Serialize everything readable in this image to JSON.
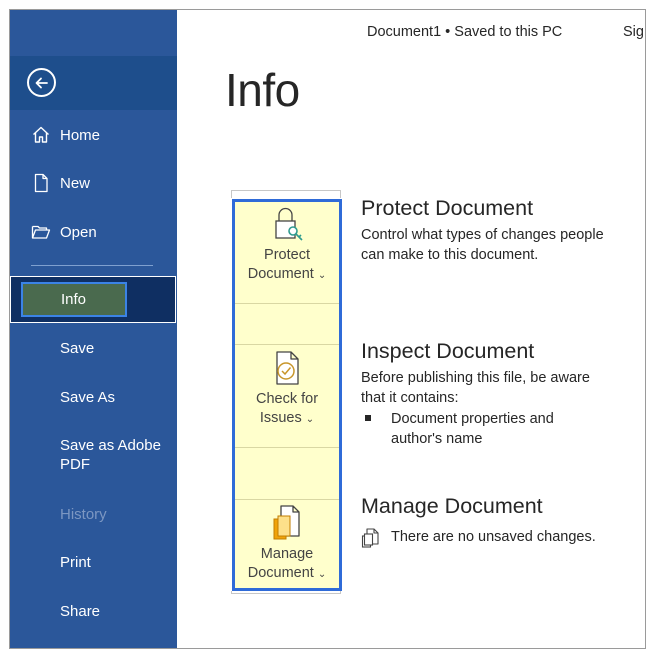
{
  "window": {
    "doc_title": "Document1  •  Saved to this PC",
    "sign_in_partial": "Sig"
  },
  "sidebar": {
    "back_icon": "back-arrow-circle-icon",
    "items": [
      {
        "label": "Home",
        "icon": "home-icon"
      },
      {
        "label": "New",
        "icon": "new-document-icon"
      },
      {
        "label": "Open",
        "icon": "open-folder-icon"
      },
      {
        "label": "Info",
        "selected": true
      },
      {
        "label": "Save"
      },
      {
        "label": "Save As"
      },
      {
        "label": "Save as Adobe PDF"
      },
      {
        "label": "History",
        "disabled": true
      },
      {
        "label": "Print"
      },
      {
        "label": "Share"
      }
    ]
  },
  "main": {
    "title": "Info",
    "tiles": [
      {
        "label_line1": "Protect",
        "label_line2": "Document",
        "icon": "lock-key-icon"
      },
      {
        "label_line1": "Check for",
        "label_line2": "Issues",
        "icon": "document-check-icon"
      },
      {
        "label_line1": "Manage",
        "label_line2": "Document",
        "icon": "manage-document-icon"
      }
    ],
    "sections": {
      "protect": {
        "title": "Protect Document",
        "text": "Control what types of changes people can make to this document."
      },
      "inspect": {
        "title": "Inspect Document",
        "text": "Before publishing this file, be aware that it contains:",
        "bullet": "Document properties and author's name"
      },
      "manage": {
        "title": "Manage Document",
        "text": "There are no unsaved changes.",
        "icon": "document-stack-icon"
      }
    }
  },
  "colors": {
    "sidebar": "#2b579a",
    "sidebar_selected": "#0f2f62",
    "info_box": "#4a6a4e",
    "highlight_border": "#2f6bd8",
    "tile_bg": "#ffffcc"
  }
}
